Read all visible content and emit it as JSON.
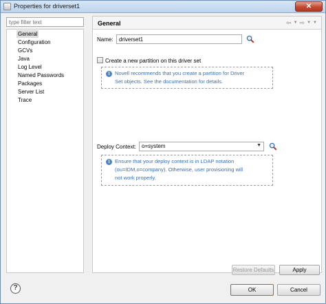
{
  "window": {
    "title": "Properties for driverset1",
    "close_symbol": "✕"
  },
  "filter": {
    "placeholder": "type filter text"
  },
  "nav": {
    "items": [
      {
        "label": "General",
        "selected": true
      },
      {
        "label": "Configuration"
      },
      {
        "label": "GCVs"
      },
      {
        "label": "Java"
      },
      {
        "label": "Log Level"
      },
      {
        "label": "Named Passwords"
      },
      {
        "label": "Packages"
      },
      {
        "label": "Server List"
      },
      {
        "label": "Trace"
      }
    ]
  },
  "page": {
    "title": "General",
    "name_label": "Name:",
    "name_value": "driverset1",
    "partition_label": "Create a new partition on this driver set",
    "partition_checked": false,
    "partition_info_line1": "Novell recommends that you create a partition for Driver",
    "partition_info_line2": "Set objects. See the documentation for details.",
    "deploy_label": "Deploy Context:",
    "deploy_value": "o=system",
    "deploy_info_line1": "Ensure that your deploy context is in LDAP notation",
    "deploy_info_line2": "(ou=IDM,o=company). Otherwise, user provisioning will",
    "deploy_info_line3": "not work properly."
  },
  "buttons": {
    "restore_defaults": "Restore Defaults",
    "apply": "Apply",
    "ok": "OK",
    "cancel": "Cancel"
  },
  "help": {
    "symbol": "?"
  },
  "colors": {
    "info_text": "#3a6fb0",
    "accent": "#4a86c8",
    "close": "#c6482f"
  },
  "icons": {
    "window": "properties-window-icon",
    "search": "magnifier-icon",
    "back": "back-arrow-icon",
    "forward": "forward-arrow-icon",
    "menu": "view-menu-icon",
    "info": "info-icon",
    "help": "help-icon"
  }
}
